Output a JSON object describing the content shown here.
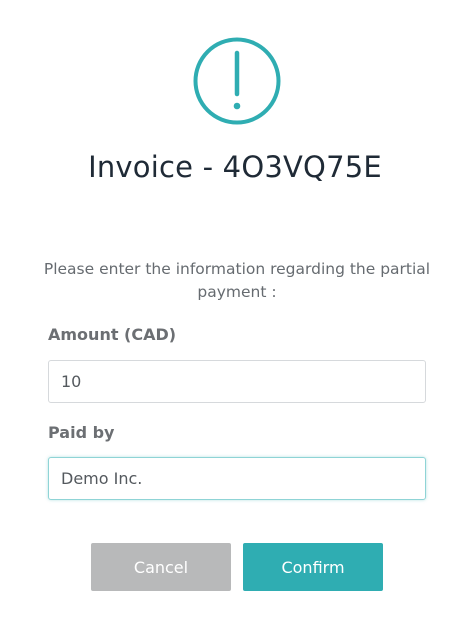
{
  "dialog": {
    "icon": "exclamation-circle-icon",
    "title": "Invoice - 4O3VQ75E",
    "instructions": "Please enter the information regarding the partial payment :"
  },
  "form": {
    "amount_label": "Amount (CAD)",
    "amount_value": "10",
    "paid_by_label": "Paid by",
    "paid_by_value": "Demo Inc."
  },
  "actions": {
    "cancel_label": "Cancel",
    "confirm_label": "Confirm"
  },
  "colors": {
    "accent": "#2fadb2",
    "cancel": "#b8b9ba",
    "title": "#1f2a36"
  }
}
